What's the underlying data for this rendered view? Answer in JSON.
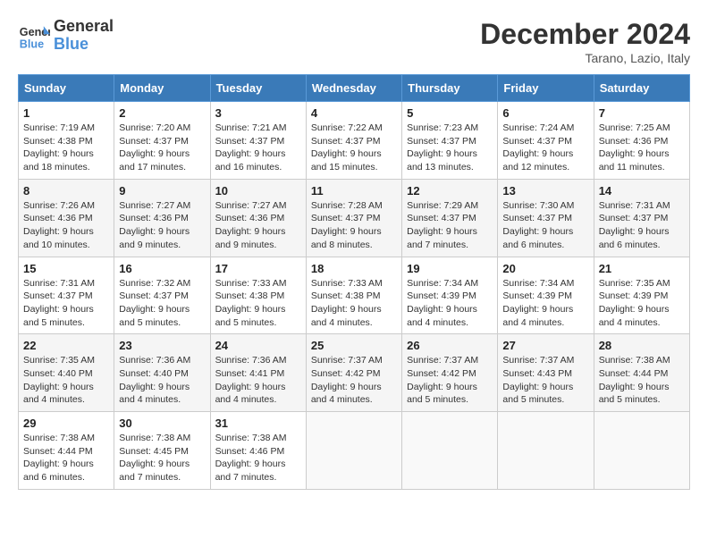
{
  "header": {
    "logo_line1": "General",
    "logo_line2": "Blue",
    "month": "December 2024",
    "location": "Tarano, Lazio, Italy"
  },
  "weekdays": [
    "Sunday",
    "Monday",
    "Tuesday",
    "Wednesday",
    "Thursday",
    "Friday",
    "Saturday"
  ],
  "weeks": [
    [
      {
        "day": "1",
        "sunrise": "7:19 AM",
        "sunset": "4:38 PM",
        "daylight": "9 hours and 18 minutes."
      },
      {
        "day": "2",
        "sunrise": "7:20 AM",
        "sunset": "4:37 PM",
        "daylight": "9 hours and 17 minutes."
      },
      {
        "day": "3",
        "sunrise": "7:21 AM",
        "sunset": "4:37 PM",
        "daylight": "9 hours and 16 minutes."
      },
      {
        "day": "4",
        "sunrise": "7:22 AM",
        "sunset": "4:37 PM",
        "daylight": "9 hours and 15 minutes."
      },
      {
        "day": "5",
        "sunrise": "7:23 AM",
        "sunset": "4:37 PM",
        "daylight": "9 hours and 13 minutes."
      },
      {
        "day": "6",
        "sunrise": "7:24 AM",
        "sunset": "4:37 PM",
        "daylight": "9 hours and 12 minutes."
      },
      {
        "day": "7",
        "sunrise": "7:25 AM",
        "sunset": "4:36 PM",
        "daylight": "9 hours and 11 minutes."
      }
    ],
    [
      {
        "day": "8",
        "sunrise": "7:26 AM",
        "sunset": "4:36 PM",
        "daylight": "9 hours and 10 minutes."
      },
      {
        "day": "9",
        "sunrise": "7:27 AM",
        "sunset": "4:36 PM",
        "daylight": "9 hours and 9 minutes."
      },
      {
        "day": "10",
        "sunrise": "7:27 AM",
        "sunset": "4:36 PM",
        "daylight": "9 hours and 9 minutes."
      },
      {
        "day": "11",
        "sunrise": "7:28 AM",
        "sunset": "4:37 PM",
        "daylight": "9 hours and 8 minutes."
      },
      {
        "day": "12",
        "sunrise": "7:29 AM",
        "sunset": "4:37 PM",
        "daylight": "9 hours and 7 minutes."
      },
      {
        "day": "13",
        "sunrise": "7:30 AM",
        "sunset": "4:37 PM",
        "daylight": "9 hours and 6 minutes."
      },
      {
        "day": "14",
        "sunrise": "7:31 AM",
        "sunset": "4:37 PM",
        "daylight": "9 hours and 6 minutes."
      }
    ],
    [
      {
        "day": "15",
        "sunrise": "7:31 AM",
        "sunset": "4:37 PM",
        "daylight": "9 hours and 5 minutes."
      },
      {
        "day": "16",
        "sunrise": "7:32 AM",
        "sunset": "4:37 PM",
        "daylight": "9 hours and 5 minutes."
      },
      {
        "day": "17",
        "sunrise": "7:33 AM",
        "sunset": "4:38 PM",
        "daylight": "9 hours and 5 minutes."
      },
      {
        "day": "18",
        "sunrise": "7:33 AM",
        "sunset": "4:38 PM",
        "daylight": "9 hours and 4 minutes."
      },
      {
        "day": "19",
        "sunrise": "7:34 AM",
        "sunset": "4:39 PM",
        "daylight": "9 hours and 4 minutes."
      },
      {
        "day": "20",
        "sunrise": "7:34 AM",
        "sunset": "4:39 PM",
        "daylight": "9 hours and 4 minutes."
      },
      {
        "day": "21",
        "sunrise": "7:35 AM",
        "sunset": "4:39 PM",
        "daylight": "9 hours and 4 minutes."
      }
    ],
    [
      {
        "day": "22",
        "sunrise": "7:35 AM",
        "sunset": "4:40 PM",
        "daylight": "9 hours and 4 minutes."
      },
      {
        "day": "23",
        "sunrise": "7:36 AM",
        "sunset": "4:40 PM",
        "daylight": "9 hours and 4 minutes."
      },
      {
        "day": "24",
        "sunrise": "7:36 AM",
        "sunset": "4:41 PM",
        "daylight": "9 hours and 4 minutes."
      },
      {
        "day": "25",
        "sunrise": "7:37 AM",
        "sunset": "4:42 PM",
        "daylight": "9 hours and 4 minutes."
      },
      {
        "day": "26",
        "sunrise": "7:37 AM",
        "sunset": "4:42 PM",
        "daylight": "9 hours and 5 minutes."
      },
      {
        "day": "27",
        "sunrise": "7:37 AM",
        "sunset": "4:43 PM",
        "daylight": "9 hours and 5 minutes."
      },
      {
        "day": "28",
        "sunrise": "7:38 AM",
        "sunset": "4:44 PM",
        "daylight": "9 hours and 5 minutes."
      }
    ],
    [
      {
        "day": "29",
        "sunrise": "7:38 AM",
        "sunset": "4:44 PM",
        "daylight": "9 hours and 6 minutes."
      },
      {
        "day": "30",
        "sunrise": "7:38 AM",
        "sunset": "4:45 PM",
        "daylight": "9 hours and 7 minutes."
      },
      {
        "day": "31",
        "sunrise": "7:38 AM",
        "sunset": "4:46 PM",
        "daylight": "9 hours and 7 minutes."
      },
      null,
      null,
      null,
      null
    ]
  ],
  "labels": {
    "sunrise": "Sunrise:",
    "sunset": "Sunset:",
    "daylight": "Daylight:"
  }
}
